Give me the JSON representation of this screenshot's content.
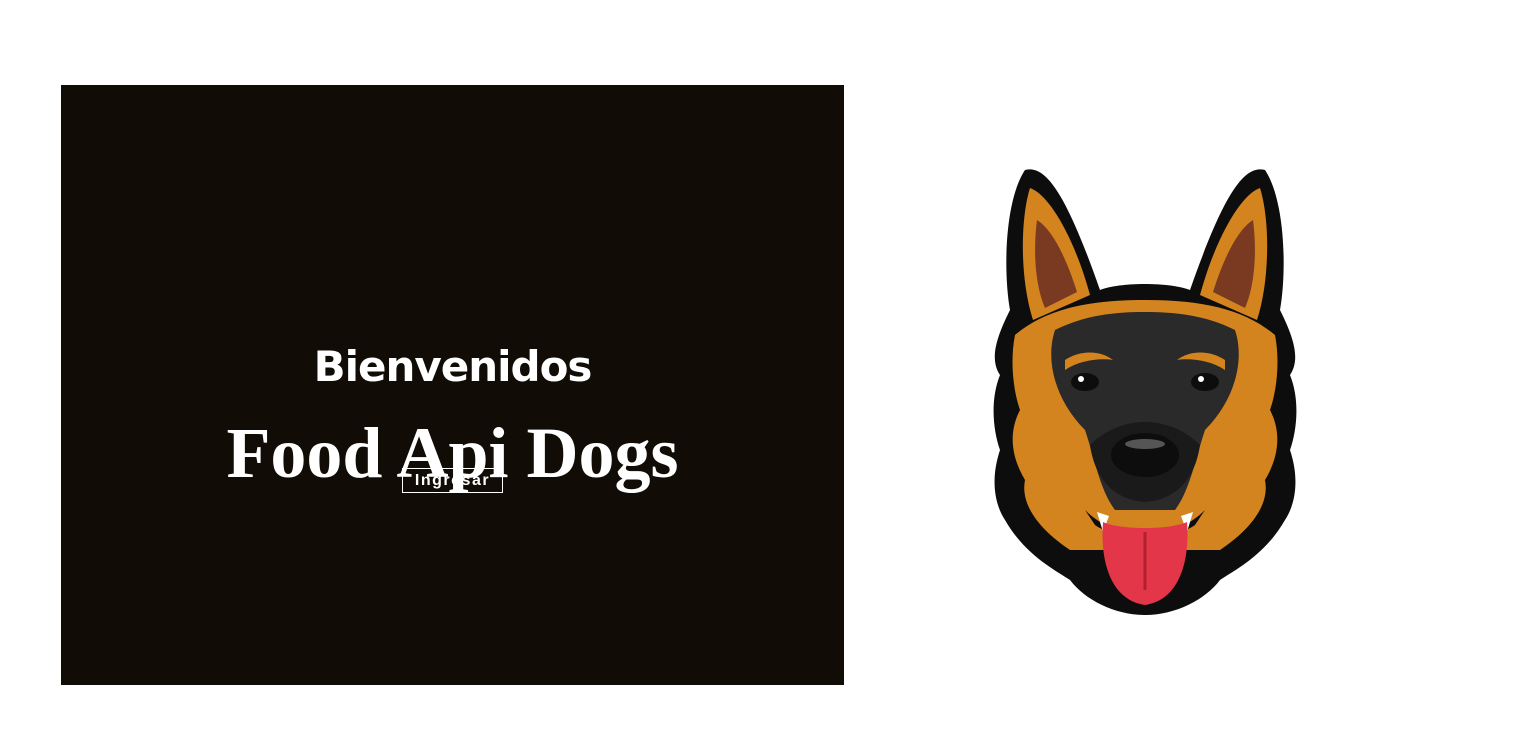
{
  "hero": {
    "welcome": "Bienvenidos",
    "title": "Food Api Dogs",
    "enter_button": "Ingresar"
  },
  "illustration": {
    "icon": "german-shepherd-dog-head",
    "colors": {
      "outline": "#0d0d0d",
      "tan": "#d4841f",
      "dark_fur": "#2a2a2a",
      "ear_inner": "#7a3a22",
      "tongue": "#e33649"
    }
  }
}
